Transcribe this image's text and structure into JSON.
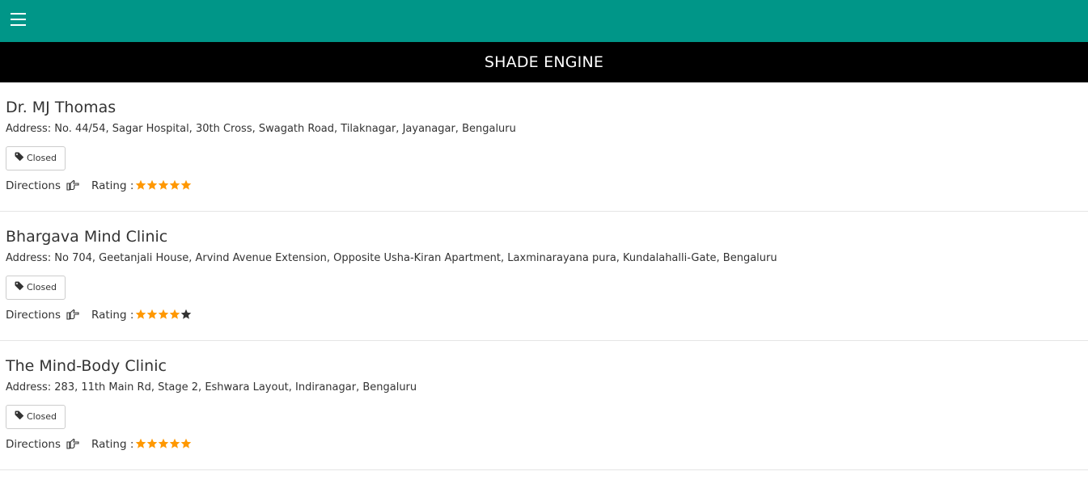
{
  "header": {
    "menu_icon": "hamburger-menu-icon",
    "title": "SHADE ENGINE",
    "colors": {
      "topbar": "#009688",
      "titlebar": "#000000"
    }
  },
  "clinics": [
    {
      "name": "Dr. MJ Thomas",
      "address": "Address: No. 44/54, Sagar Hospital, 30th Cross, Swagath Road, Tilaknagar, Jayanagar, Bengaluru",
      "status": "Closed",
      "directions_label": "Directions",
      "rating_label": "Rating :",
      "rating": 5
    },
    {
      "name": "Bhargava Mind Clinic",
      "address": "Address: No 704, Geetanjali House, Arvind Avenue Extension, Opposite Usha-Kiran Apartment, Laxminarayana pura, Kundalahalli-Gate, Bengaluru",
      "status": "Closed",
      "directions_label": "Directions",
      "rating_label": "Rating :",
      "rating": 4
    },
    {
      "name": "The Mind-Body Clinic",
      "address": "Address: 283, 11th Main Rd, Stage 2, Eshwara Layout, Indiranagar, Bengaluru",
      "status": "Closed",
      "directions_label": "Directions",
      "rating_label": "Rating :",
      "rating": 5
    }
  ],
  "rating_max": 5,
  "icons": {
    "status": "tag-icon",
    "directions": "pointing-hand-icon",
    "rating": "star-icon"
  },
  "colors": {
    "star_filled": "#FF9800",
    "star_empty": "#333333"
  }
}
